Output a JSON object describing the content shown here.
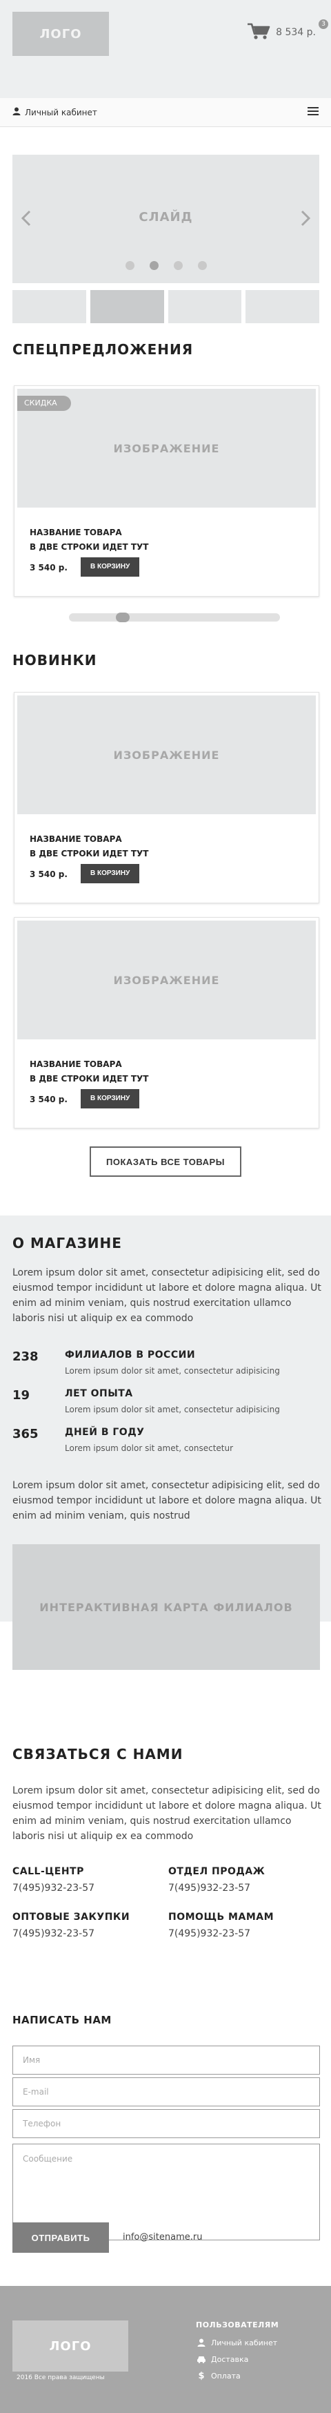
{
  "header": {
    "logo": "ЛОГО",
    "cart_sum": "8 534 р.",
    "cart_count": "3",
    "account_label": "Личный кабинет"
  },
  "slider": {
    "label": "СЛАЙД",
    "dots": 4,
    "active_dot": 2
  },
  "specials": {
    "title": "СПЕЦПРЕДЛОЖЕНИЯ",
    "card": {
      "badge": "СКИДКА",
      "image_label": "ИЗОБРАЖЕНИЕ",
      "name_line1": "НАЗВАНИЕ ТОВАРА",
      "name_line2": "В ДВЕ СТРОКИ ИДЕТ ТУТ",
      "price": "3 540 р.",
      "button": "В КОРЗИНУ"
    }
  },
  "new": {
    "title": "НОВИНКИ",
    "cards": [
      {
        "image_label": "ИЗОБРАЖЕНИЕ",
        "name_line1": "НАЗВАНИЕ ТОВАРА",
        "name_line2": "В ДВЕ СТРОКИ ИДЕТ ТУТ",
        "price": "3 540 р.",
        "button": "В КОРЗИНУ"
      },
      {
        "image_label": "ИЗОБРАЖЕНИЕ",
        "name_line1": "НАЗВАНИЕ ТОВАРА",
        "name_line2": "В ДВЕ СТРОКИ ИДЕТ ТУТ",
        "price": "3 540 р.",
        "button": "В КОРЗИНУ"
      }
    ],
    "show_all": "ПОКАЗАТЬ ВСЕ ТОВАРЫ"
  },
  "about": {
    "title": "О МАГАЗИНЕ",
    "para1": "Lorem ipsum dolor sit amet, consectetur adipisicing elit, sed do eiusmod tempor incididunt ut labore et dolore magna aliqua. Ut enim ad minim veniam, quis nostrud exercitation ullamco laboris nisi ut aliquip ex ea commodo",
    "stats": [
      {
        "num": "238",
        "title": "ФИЛИАЛОВ В РОССИИ",
        "desc": "Lorem ipsum dolor sit amet, consectetur adipisicing"
      },
      {
        "num": "19",
        "title": "ЛЕТ ОПЫТА",
        "desc": "Lorem ipsum dolor sit amet, consectetur adipisicing"
      },
      {
        "num": "365",
        "title": "ДНЕЙ В ГОДУ",
        "desc": "Lorem ipsum dolor sit amet, consectetur"
      }
    ],
    "para2": "Lorem ipsum dolor sit amet, consectetur adipisicing elit, sed do eiusmod tempor incididunt ut labore et dolore magna aliqua. Ut enim ad minim veniam, quis nostrud",
    "map_label": "ИНТЕРАКТИВНАЯ КАРТА ФИЛИАЛОВ"
  },
  "contacts": {
    "title": "СВЯЗАТЬСЯ С НАМИ",
    "para": "Lorem ipsum dolor sit amet, consectetur adipisicing elit, sed do eiusmod tempor incididunt ut labore et dolore magna aliqua. Ut enim ad minim veniam, quis nostrud exercitation ullamco laboris nisi ut aliquip ex ea commodo",
    "groups": [
      {
        "title": "CALL-ЦЕНТР",
        "phone": "7(495)932-23-57"
      },
      {
        "title": "ОТДЕЛ ПРОДАЖ",
        "phone": "7(495)932-23-57"
      },
      {
        "title": "ОПТОВЫЕ ЗАКУПКИ",
        "phone": "7(495)932-23-57"
      },
      {
        "title": "ПОМОЩЬ МАМАМ",
        "phone": "7(495)932-23-57"
      }
    ],
    "write_title": "НАПИСАТЬ НАМ",
    "form": {
      "name_placeholder": "Имя",
      "email_placeholder": "E-mail",
      "phone_placeholder": "Телефон",
      "message_placeholder": "Сообщение",
      "submit": "ОТПРАВИТЬ",
      "email": "info@sitename.ru"
    }
  },
  "footer": {
    "logo": "ЛОГО",
    "copyright": "2016 Все права защищены",
    "users_title": "ПОЛЬЗОВАТЕЛЯМ",
    "links": [
      {
        "icon": "user-icon",
        "label": "Личный кабинет"
      },
      {
        "icon": "car-icon",
        "label": "Доставка"
      },
      {
        "icon": "dollar-icon",
        "label": "Оплата"
      }
    ]
  },
  "colors": {
    "header_bg": "#edeff0",
    "placeholder_gray": "#e4e6e7",
    "dark_button": "#444444",
    "footer_bg": "#a7a7a7"
  }
}
